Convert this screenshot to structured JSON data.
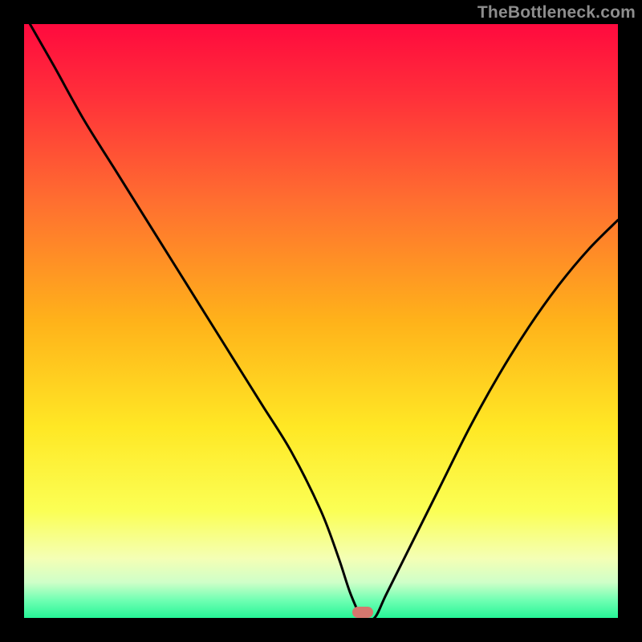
{
  "watermark": "TheBottleneck.com",
  "marker": {
    "x_pct": 57.0,
    "y_pct": 99.0
  },
  "gradient_stops": [
    {
      "pct": 0,
      "color": "#ff0a3e"
    },
    {
      "pct": 12,
      "color": "#ff2f3a"
    },
    {
      "pct": 30,
      "color": "#ff6f30"
    },
    {
      "pct": 50,
      "color": "#ffb21a"
    },
    {
      "pct": 68,
      "color": "#ffe825"
    },
    {
      "pct": 82,
      "color": "#fbff55"
    },
    {
      "pct": 90,
      "color": "#f4ffb5"
    },
    {
      "pct": 94,
      "color": "#cfffc8"
    },
    {
      "pct": 97,
      "color": "#70ffb3"
    },
    {
      "pct": 100,
      "color": "#26f597"
    }
  ],
  "chart_data": {
    "type": "line",
    "title": "",
    "xlabel": "",
    "ylabel": "",
    "xlim": [
      0,
      100
    ],
    "ylim": [
      0,
      100
    ],
    "series": [
      {
        "name": "bottleneck-curve",
        "x": [
          1,
          5,
          10,
          15,
          20,
          25,
          30,
          35,
          40,
          45,
          50,
          53,
          55,
          57,
          59,
          61,
          65,
          70,
          75,
          80,
          85,
          90,
          95,
          100
        ],
        "y": [
          100,
          93,
          84,
          76,
          68,
          60,
          52,
          44,
          36,
          28,
          18,
          10,
          4,
          0,
          0,
          4,
          12,
          22,
          32,
          41,
          49,
          56,
          62,
          67
        ]
      }
    ],
    "valley_flat_range_x": [
      55,
      59
    ],
    "annotations": [
      {
        "type": "marker-pill",
        "x": 57,
        "y": 0,
        "color": "#d5776e"
      }
    ]
  }
}
